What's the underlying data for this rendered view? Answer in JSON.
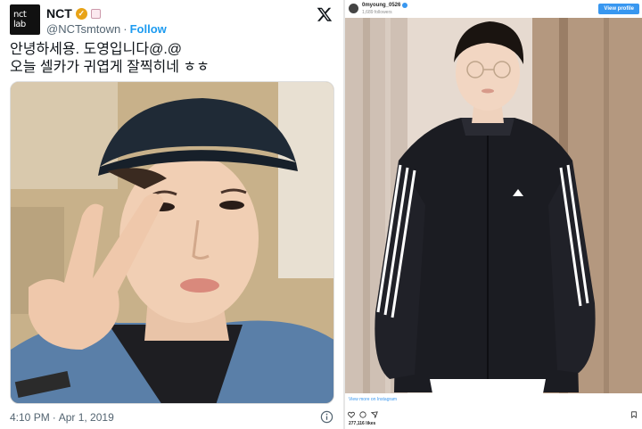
{
  "tweet": {
    "avatar_text_line1": "nct",
    "avatar_text_line2": "lab",
    "name": "NCT",
    "handle": "@NCTsmtown",
    "separator": "·",
    "follow_label": "Follow",
    "text_line1": "안녕하세용. 도영입니다@.@",
    "text_line2": "오늘 셀카가 귀엽게 잘찍히네 ㅎㅎ",
    "time": "4:10 PM",
    "date": "Apr 1, 2019",
    "time_separator": "·",
    "colors": {
      "accent": "#1d9bf0",
      "verified": "#e8a317",
      "muted": "#536471"
    }
  },
  "instagram": {
    "username": "0myoung_0526",
    "followers": "1,689 followers",
    "view_profile_label": "View profile",
    "view_more_label": "View more on Instagram",
    "likes": "277,116 likes",
    "colors": {
      "accent": "#3897f0"
    }
  }
}
